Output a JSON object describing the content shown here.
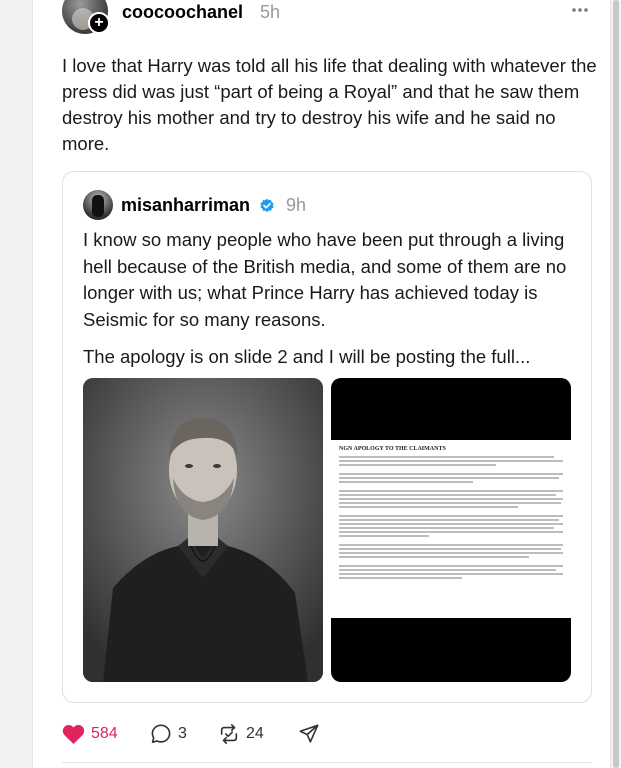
{
  "post": {
    "author": "coocoochanel",
    "time": "5h",
    "more_icon": "more-horizontal-icon",
    "text": "I love that Harry was told all his life that dealing with whatever the press did was just “part of being a Royal” and that he saw them destroy his mother and try to destroy his wife and he said no more."
  },
  "quote": {
    "author": "misanharriman",
    "verified": true,
    "time": "9h",
    "text": "I know so many people who have been put through a living hell because of the British media, and some of them are no longer with us; what Prince Harry has achieved today is Seismic for so many reasons.",
    "text2": "The apology is on slide 2 and I will be posting the full...",
    "media": [
      {
        "type": "photo",
        "icon": "portrait-photo"
      },
      {
        "type": "document",
        "doc_title": "NGN APOLOGY TO THE CLAIMANTS"
      }
    ]
  },
  "actions": {
    "likes": "584",
    "replies": "3",
    "reposts": "24"
  },
  "colors": {
    "like": "#e0245e",
    "verified": "#1d9bf0",
    "muted": "#999999"
  }
}
